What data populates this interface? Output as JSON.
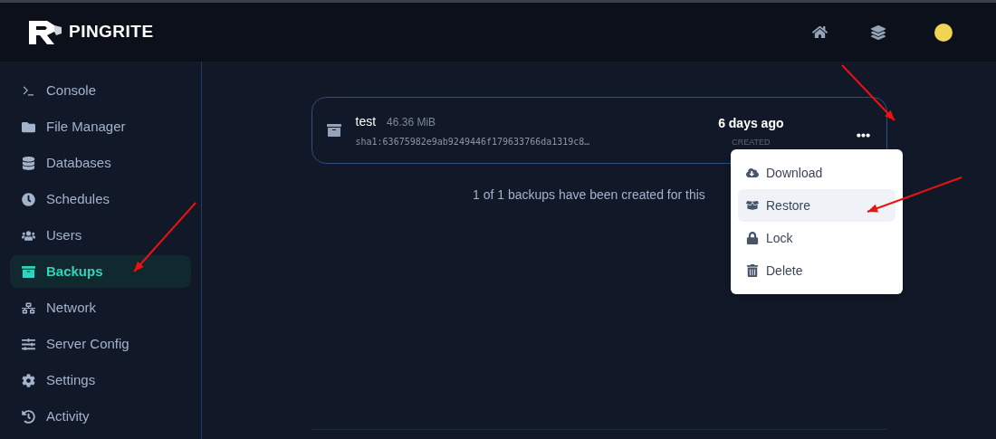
{
  "header": {
    "brand": "PINGRITE"
  },
  "sidebar": {
    "items": [
      {
        "label": "Console",
        "selected": false
      },
      {
        "label": "File Manager",
        "selected": false
      },
      {
        "label": "Databases",
        "selected": false
      },
      {
        "label": "Schedules",
        "selected": false
      },
      {
        "label": "Users",
        "selected": false
      },
      {
        "label": "Backups",
        "selected": true
      },
      {
        "label": "Network",
        "selected": false
      },
      {
        "label": "Server Config",
        "selected": false
      },
      {
        "label": "Settings",
        "selected": false
      },
      {
        "label": "Activity",
        "selected": false
      }
    ]
  },
  "backup": {
    "name": "test",
    "size": "46.36 MiB",
    "checksum": "sha1:63675982e9ab9249446f179633766da1319c8…",
    "date": "6 days ago",
    "date_label": "CREATED"
  },
  "summary": "1 of 1 backups have been created for this",
  "menu": {
    "items": [
      {
        "label": "Download",
        "selected": false
      },
      {
        "label": "Restore",
        "selected": true
      },
      {
        "label": "Lock",
        "selected": false
      },
      {
        "label": "Delete",
        "selected": false
      }
    ]
  }
}
